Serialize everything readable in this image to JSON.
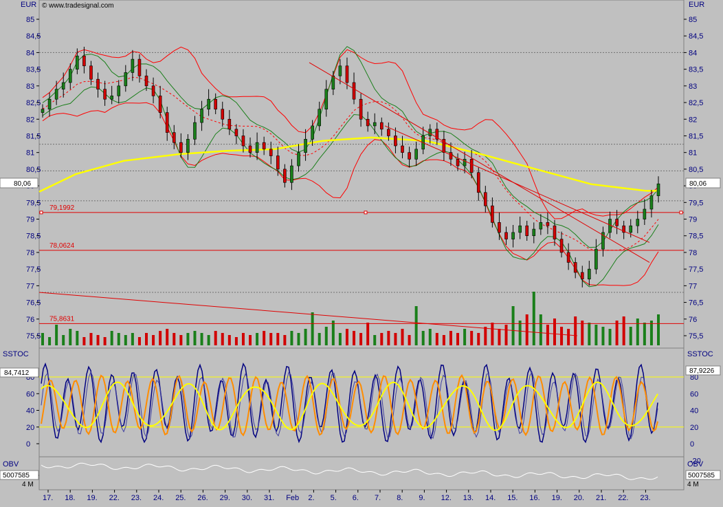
{
  "chart_data": [
    {
      "type": "candlestick",
      "panel": "price",
      "unit_label": "EUR",
      "watermark": "© www.tradesignal.com",
      "ylim": [
        75.2,
        85.3
      ],
      "y_ticks": [
        "75,5",
        "76",
        "76,5",
        "77",
        "77,5",
        "78",
        "78,5",
        "79",
        "79,5",
        "80",
        "80,5",
        "81",
        "81,5",
        "82",
        "82,5",
        "83",
        "83,5",
        "84",
        "84,5",
        "85"
      ],
      "x_labels": [
        "17.",
        "18.",
        "19.",
        "22.",
        "23.",
        "24.",
        "25.",
        "26.",
        "29.",
        "30.",
        "31.",
        "Feb",
        "2.",
        "5.",
        "6.",
        "7.",
        "8.",
        "9.",
        "12.",
        "13.",
        "14.",
        "15.",
        "16.",
        "19.",
        "20.",
        "21.",
        "22.",
        "23."
      ],
      "last_value_label": "80,06",
      "last_value": 80.06,
      "horizontal_levels": [
        {
          "value": 79.1992,
          "label": "79,1992"
        },
        {
          "value": 78.0624,
          "label": "78,0624"
        },
        {
          "value": 75.8631,
          "label": "75,8631"
        }
      ],
      "closes_approx": [
        82.3,
        82.6,
        82.9,
        83.1,
        83.5,
        83.9,
        83.6,
        83.2,
        82.9,
        82.6,
        82.7,
        83.0,
        83.4,
        83.8,
        83.3,
        83.0,
        82.7,
        82.2,
        81.6,
        81.3,
        81.0,
        81.4,
        81.9,
        82.3,
        82.6,
        82.3,
        82.0,
        81.7,
        81.5,
        81.2,
        81.0,
        81.3,
        81.1,
        80.9,
        80.5,
        80.1,
        80.6,
        81.0,
        81.4,
        81.8,
        82.3,
        82.9,
        83.3,
        83.6,
        83.1,
        82.6,
        82.0,
        81.8,
        81.9,
        81.7,
        81.5,
        81.2,
        81.0,
        80.8,
        81.1,
        81.5,
        81.7,
        81.4,
        81.0,
        80.8,
        80.6,
        80.8,
        80.4,
        79.8,
        79.4,
        78.9,
        78.6,
        78.4,
        78.6,
        78.8,
        78.5,
        78.7,
        78.9,
        78.8,
        78.4,
        78.0,
        77.7,
        77.4,
        77.2,
        77.5,
        78.1,
        78.6,
        79.0,
        78.8,
        78.6,
        78.8,
        79.0,
        79.3,
        79.7,
        80.06
      ],
      "volume_ylim": [
        0,
        100
      ],
      "volume_values_approx": [
        30,
        20,
        50,
        25,
        40,
        35,
        20,
        30,
        25,
        20,
        35,
        30,
        25,
        30,
        20,
        30,
        25,
        35,
        40,
        30,
        25,
        30,
        35,
        30,
        25,
        35,
        30,
        25,
        20,
        30,
        25,
        30,
        35,
        30,
        30,
        25,
        35,
        30,
        40,
        80,
        30,
        45,
        60,
        30,
        40,
        35,
        30,
        55,
        25,
        30,
        35,
        30,
        40,
        25,
        95,
        35,
        40,
        30,
        25,
        35,
        30,
        40,
        35,
        30,
        45,
        55,
        40,
        50,
        95,
        60,
        75,
        130,
        75,
        50,
        65,
        45,
        40,
        70,
        60,
        55,
        50,
        45,
        40,
        60,
        70,
        45,
        65,
        55,
        60,
        75
      ],
      "volume_colors": [
        "#d10000",
        "#1a7f1a"
      ],
      "series": [
        {
          "name": "price",
          "color": "#000000"
        },
        {
          "name": "sma200",
          "color": "#ffff00"
        },
        {
          "name": "bb_upper",
          "color": "#ff0000"
        },
        {
          "name": "bb_lower",
          "color": "#ff0000"
        },
        {
          "name": "bb_mid",
          "color": "#ff0000"
        },
        {
          "name": "channel",
          "color": "#1a7f1a"
        }
      ]
    },
    {
      "type": "line",
      "panel": "oscillator",
      "label": "SSTOC",
      "ylim": [
        -5,
        100
      ],
      "y_ticks": [
        "0",
        "20",
        "40",
        "60",
        "80"
      ],
      "right_ticks": [
        "20",
        "40",
        "60",
        "80"
      ],
      "left_value_label": "84,7412",
      "right_value_label": "87,9226",
      "levels": [
        20,
        80
      ],
      "series": [
        {
          "name": "fast",
          "color": "#000080"
        },
        {
          "name": "slow",
          "color": "#ff8c00"
        },
        {
          "name": "smooth",
          "color": "#ffff00"
        }
      ]
    },
    {
      "type": "line",
      "panel": "obv",
      "label": "OBV",
      "left_value_label": "5007585",
      "right_value_label": "5007585",
      "axis_label": "4 M",
      "series": [
        {
          "name": "obv",
          "color": "#ffffff"
        }
      ]
    }
  ]
}
